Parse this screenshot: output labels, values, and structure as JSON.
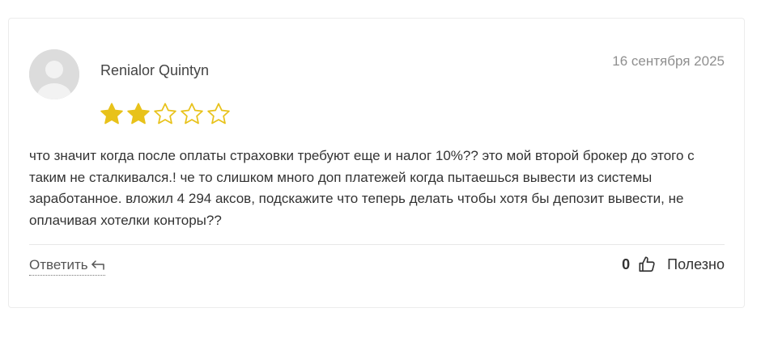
{
  "review": {
    "author": "Renialor Quintyn",
    "date": "16 сентября 2025",
    "rating": {
      "value": 2,
      "max": 5,
      "filled_color": "#e8c21a",
      "empty_color": "#e8c21a"
    },
    "text": "что значит когда после оплаты страховки требуют еще и налог 10%?? это мой второй брокер до этого с таким не сталкивался.! че то слишком много доп платежей когда пытаешься вывести из системы заработанное. вложил 4 294 аксов, подскажите что теперь делать чтобы хотя бы депозит вывести, не оплачивая хотелки конторы??",
    "avatar_icon": "user-avatar-placeholder-icon"
  },
  "actions": {
    "reply_label": "Ответить",
    "reply_icon": "reply-arrow-icon",
    "helpful_count": "0",
    "helpful_icon": "thumbs-up-icon",
    "helpful_label": "Полезно"
  }
}
